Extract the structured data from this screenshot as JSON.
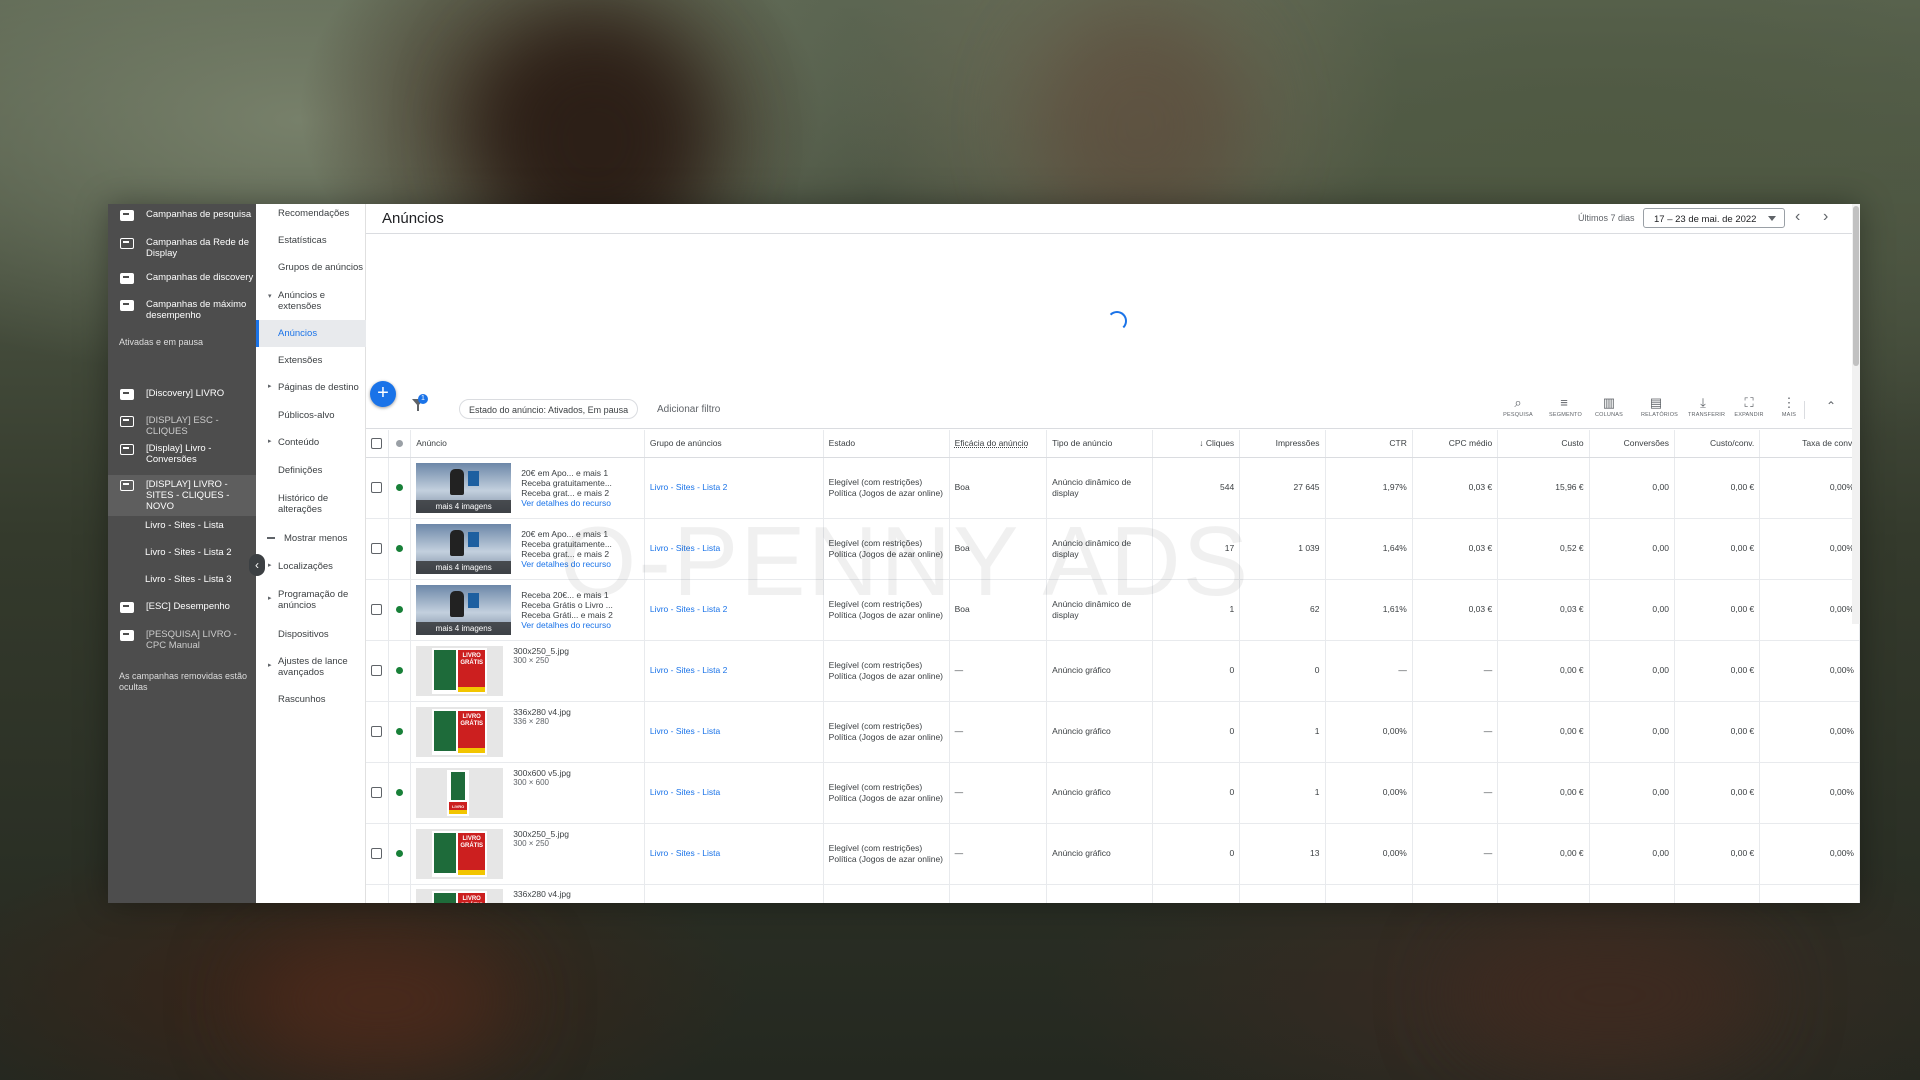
{
  "dark_nav": {
    "campaign_types": [
      {
        "label": "Campanhas de pesquisa",
        "icon": "search-campaign-icon"
      },
      {
        "label": "Campanhas da Rede de Display",
        "icon": "display-campaign-icon"
      },
      {
        "label": "Campanhas de discovery",
        "icon": "discovery-campaign-icon"
      },
      {
        "label": "Campanhas de máximo desempenho",
        "icon": "performance-max-icon"
      }
    ],
    "section_label": "Ativadas e em pausa",
    "campaigns": [
      {
        "label": "[Discovery] LIVRO",
        "icon": "discovery-campaign-icon"
      },
      {
        "label": "[DISPLAY] ESC - CLIQUES",
        "icon": "display-campaign-icon"
      },
      {
        "label": "[Display] Livro - Conversões",
        "icon": "display-campaign-icon"
      },
      {
        "label": "[DISPLAY] LIVRO - SITES - CLIQUES - NOVO",
        "icon": "display-campaign-icon"
      }
    ],
    "ad_groups": [
      "Livro - Sites - Lista",
      "Livro - Sites - Lista 2",
      "Livro - Sites - Lista 3"
    ],
    "more_campaigns": [
      {
        "label": "[ESC] Desempenho",
        "icon": "performance-max-icon"
      },
      {
        "label": "[PESQUISA] LIVRO - CPC Manual",
        "icon": "search-campaign-icon"
      }
    ],
    "footer": "As campanhas removidas estão ocultas"
  },
  "mid_nav": {
    "items": [
      "Recomendações",
      "Estatísticas",
      "Grupos de anúncios",
      "Anúncios e extensões",
      "Anúncios",
      "Extensões",
      "Páginas de destino",
      "Públicos-alvo",
      "Conteúdo",
      "Definições",
      "Histórico de alterações",
      "Mostrar menos",
      "Localizações",
      "Programação de anúncios",
      "Dispositivos",
      "Ajustes de lance avançados",
      "Rascunhos"
    ]
  },
  "header": {
    "title": "Anúncios",
    "range_label": "Últimos 7 dias",
    "date_range": "17 – 23 de mai. de 2022"
  },
  "toolbar": {
    "filter_count": "1",
    "filter_chip": "Estado do anúncio: Ativados, Em pausa",
    "add_filter": "Adicionar filtro",
    "buttons": [
      {
        "label": "PESQUISA",
        "icon": "search-icon"
      },
      {
        "label": "SEGMENTO",
        "icon": "segment-icon"
      },
      {
        "label": "COLUNAS",
        "icon": "columns-icon"
      },
      {
        "label": "RELATÓRIOS",
        "icon": "reports-icon"
      },
      {
        "label": "TRANSFERIR",
        "icon": "download-icon"
      },
      {
        "label": "EXPANDIR",
        "icon": "expand-icon"
      },
      {
        "label": "MAIS",
        "icon": "more-vert-icon"
      }
    ]
  },
  "table": {
    "columns": [
      "Anúncio",
      "Grupo de anúncios",
      "Estado",
      "Eficácia do anúncio",
      "Tipo de anúncio",
      "Cliques",
      "Impressões",
      "CTR",
      "CPC médio",
      "Custo",
      "Conversões",
      "Custo/conv.",
      "Taxa de conv."
    ],
    "rows": [
      {
        "ad_line1": "20€ em Apo...  e mais 1",
        "ad_line2": "Receba gratuitamente...",
        "ad_line3": "Receba grat...  e mais 2",
        "ad_link": "Ver detalhes do recurso",
        "thumb_caption": "mais 4 imagens",
        "ad_group": "Livro - Sites - Lista 2",
        "status1": "Elegível (com restrições)",
        "status2": "Política (Jogos de azar online)",
        "strength": "Boa",
        "type": "Anúncio dinâmico de display",
        "clicks": "544",
        "impressions": "27 645",
        "ctr": "1,97%",
        "cpc": "0,03 €",
        "cost": "15,96 €",
        "conversions": "0,00",
        "cost_conv": "0,00 €",
        "conv_rate": "0,00%"
      },
      {
        "ad_line1": "20€ em Apo...  e mais 1",
        "ad_line2": "Receba gratuitamente...",
        "ad_line3": "Receba grat...  e mais 2",
        "ad_link": "Ver detalhes do recurso",
        "thumb_caption": "mais 4 imagens",
        "ad_group": "Livro - Sites - Lista",
        "status1": "Elegível (com restrições)",
        "status2": "Política (Jogos de azar online)",
        "strength": "Boa",
        "type": "Anúncio dinâmico de display",
        "clicks": "17",
        "impressions": "1 039",
        "ctr": "1,64%",
        "cpc": "0,03 €",
        "cost": "0,52 €",
        "conversions": "0,00",
        "cost_conv": "0,00 €",
        "conv_rate": "0,00%"
      },
      {
        "ad_line1": "Receba 20€...  e mais 1",
        "ad_line2": "Receba Grátis o Livro ...",
        "ad_line3": "Receba Gráti...  e mais 2",
        "ad_link": "Ver detalhes do recurso",
        "thumb_caption": "mais 4 imagens",
        "ad_group": "Livro - Sites - Lista 2",
        "status1": "Elegível (com restrições)",
        "status2": "Política (Jogos de azar online)",
        "strength": "Boa",
        "type": "Anúncio dinâmico de display",
        "clicks": "1",
        "impressions": "62",
        "ctr": "1,61%",
        "cpc": "0,03 €",
        "cost": "0,03 €",
        "conversions": "0,00",
        "cost_conv": "0,00 €",
        "conv_rate": "0,00%"
      },
      {
        "file": "300x250_5.jpg",
        "dims": "300 × 250",
        "ad_group": "Livro - Sites - Lista 2",
        "status1": "Elegível (com restrições)",
        "status2": "Política (Jogos de azar online)",
        "strength": "—",
        "type": "Anúncio gráfico",
        "clicks": "0",
        "impressions": "0",
        "ctr": "—",
        "cpc": "—",
        "cost": "0,00 €",
        "conversions": "0,00",
        "cost_conv": "0,00 €",
        "conv_rate": "0,00%"
      },
      {
        "file": "336x280 v4.jpg",
        "dims": "336 × 280",
        "ad_group": "Livro - Sites - Lista",
        "status1": "Elegível (com restrições)",
        "status2": "Política (Jogos de azar online)",
        "strength": "—",
        "type": "Anúncio gráfico",
        "clicks": "0",
        "impressions": "1",
        "ctr": "0,00%",
        "cpc": "—",
        "cost": "0,00 €",
        "conversions": "0,00",
        "cost_conv": "0,00 €",
        "conv_rate": "0,00%"
      },
      {
        "file": "300x600 v5.jpg",
        "dims": "300 × 600",
        "ad_group": "Livro - Sites - Lista",
        "status1": "Elegível (com restrições)",
        "status2": "Política (Jogos de azar online)",
        "strength": "—",
        "type": "Anúncio gráfico",
        "clicks": "0",
        "impressions": "1",
        "ctr": "0,00%",
        "cpc": "—",
        "cost": "0,00 €",
        "conversions": "0,00",
        "cost_conv": "0,00 €",
        "conv_rate": "0,00%"
      },
      {
        "file": "300x250_5.jpg",
        "dims": "300 × 250",
        "ad_group": "Livro - Sites - Lista",
        "status1": "Elegível (com restrições)",
        "status2": "Política (Jogos de azar online)",
        "strength": "—",
        "type": "Anúncio gráfico",
        "clicks": "0",
        "impressions": "13",
        "ctr": "0,00%",
        "cpc": "—",
        "cost": "0,00 €",
        "conversions": "0,00",
        "cost_conv": "0,00 €",
        "conv_rate": "0,00%"
      },
      {
        "file": "336x280 v4.jpg"
      }
    ],
    "banner_text": "LIVRO GRÁTIS"
  },
  "watermark": "O-PENNY ADS",
  "colors": {
    "accent": "#1a73e8",
    "enabled": "#188038",
    "nav_dark": "#4d4d4d"
  }
}
